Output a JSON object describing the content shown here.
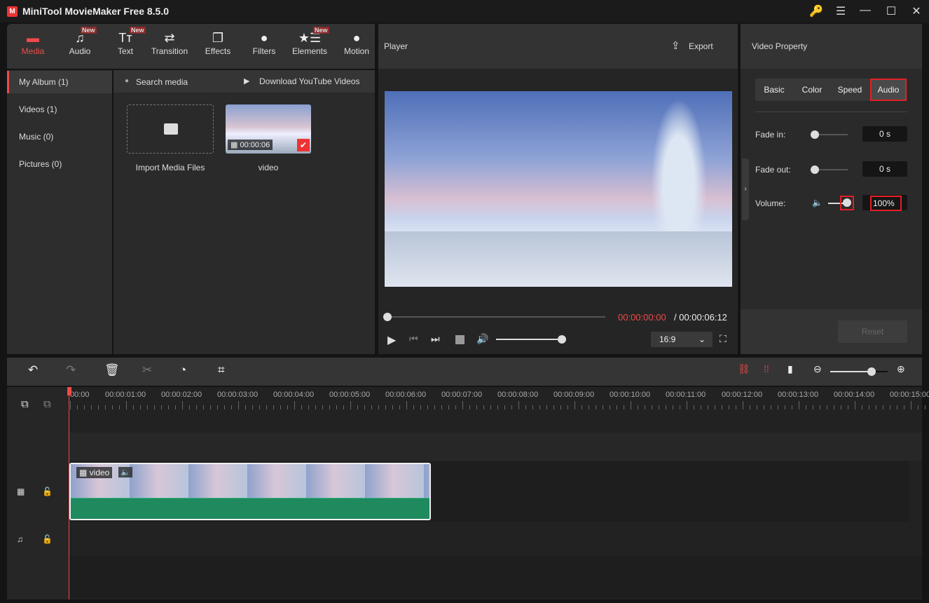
{
  "app": {
    "title": "MiniTool MovieMaker Free 8.5.0",
    "logo_letter": "M"
  },
  "window": {
    "key_icon": "🔑",
    "menu_icon": "☰",
    "min_icon": "—",
    "max_icon": "☐",
    "close_icon": "✕"
  },
  "toolbar": [
    {
      "label": "Media",
      "icon": "▬",
      "active": true
    },
    {
      "label": "Audio",
      "icon": "♫",
      "badge": "New"
    },
    {
      "label": "Text",
      "icon": "Tт",
      "badge": "New"
    },
    {
      "label": "Transition",
      "icon": "⇄"
    },
    {
      "label": "Effects",
      "icon": "❐"
    },
    {
      "label": "Filters",
      "icon": "●"
    },
    {
      "label": "Elements",
      "icon": "★☰",
      "badge": "New"
    },
    {
      "label": "Motion",
      "icon": "●"
    }
  ],
  "sidebar": [
    {
      "label": "My Album (1)"
    },
    {
      "label": "Videos (1)"
    },
    {
      "label": "Music (0)"
    },
    {
      "label": "Pictures (0)"
    }
  ],
  "media": {
    "search": "Search media",
    "download": "Download YouTube Videos",
    "import_label": "Import Media Files",
    "clip_name": "video",
    "clip_duration": "00:00:06"
  },
  "player": {
    "title": "Player",
    "export": "Export",
    "current_time": "00:00:00:00",
    "total_time": "/ 00:00:06:12",
    "aspect": "16:9",
    "progress": 0,
    "volume": 1.0
  },
  "property": {
    "title": "Video Property",
    "tabs": [
      "Basic",
      "Color",
      "Speed",
      "Audio"
    ],
    "active_tab": "Audio",
    "fade_in_label": "Fade in:",
    "fade_in": "0 s",
    "fade_out_label": "Fade out:",
    "fade_out": "0 s",
    "volume_label": "Volume:",
    "volume": "100%",
    "reset": "Reset"
  },
  "timeline": {
    "ticks": [
      "00:00",
      "00:00:01:00",
      "00:00:02:00",
      "00:00:03:00",
      "00:00:04:00",
      "00:00:05:00",
      "00:00:06:00",
      "00:00:07:00",
      "00:00:08:00",
      "00:00:09:00",
      "00:00:10:00",
      "00:00:11:00",
      "00:00:12:00",
      "00:00:13:00",
      "00:00:14:00",
      "00:00:15:00"
    ],
    "clip_label": "video",
    "accent": "#f04a4a"
  }
}
